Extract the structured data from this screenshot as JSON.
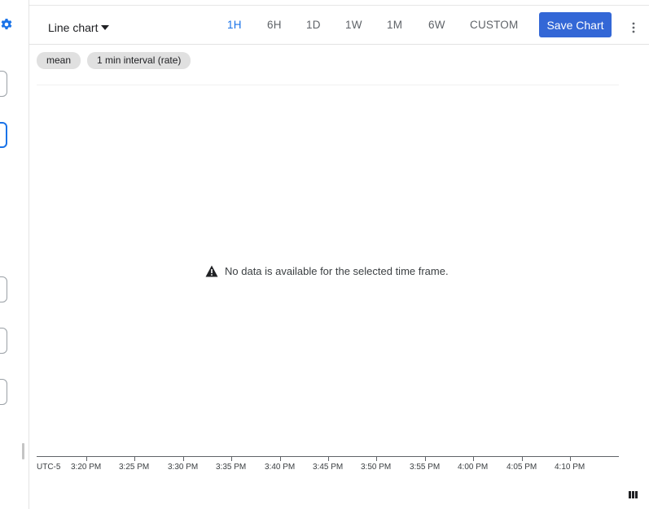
{
  "toolbar": {
    "chart_type_label": "Line chart",
    "ranges": [
      "1H",
      "6H",
      "1D",
      "1W",
      "1M",
      "6W",
      "CUSTOM"
    ],
    "active_range": "1H",
    "save_label": "Save Chart"
  },
  "chips": [
    "mean",
    "1 min interval (rate)"
  ],
  "empty_state": "No data is available for the selected time frame.",
  "axis": {
    "timezone": "UTC-5",
    "ticks": [
      "3:20 PM",
      "3:25 PM",
      "3:30 PM",
      "3:35 PM",
      "3:40 PM",
      "3:45 PM",
      "3:50 PM",
      "3:55 PM",
      "4:00 PM",
      "4:05 PM",
      "4:10 PM"
    ]
  },
  "colors": {
    "accent": "#1a73e8",
    "button": "#3367d6"
  },
  "icons": [
    "gear-icon",
    "caret-down-icon",
    "more-vert-icon",
    "warning-icon",
    "columns-icon"
  ]
}
